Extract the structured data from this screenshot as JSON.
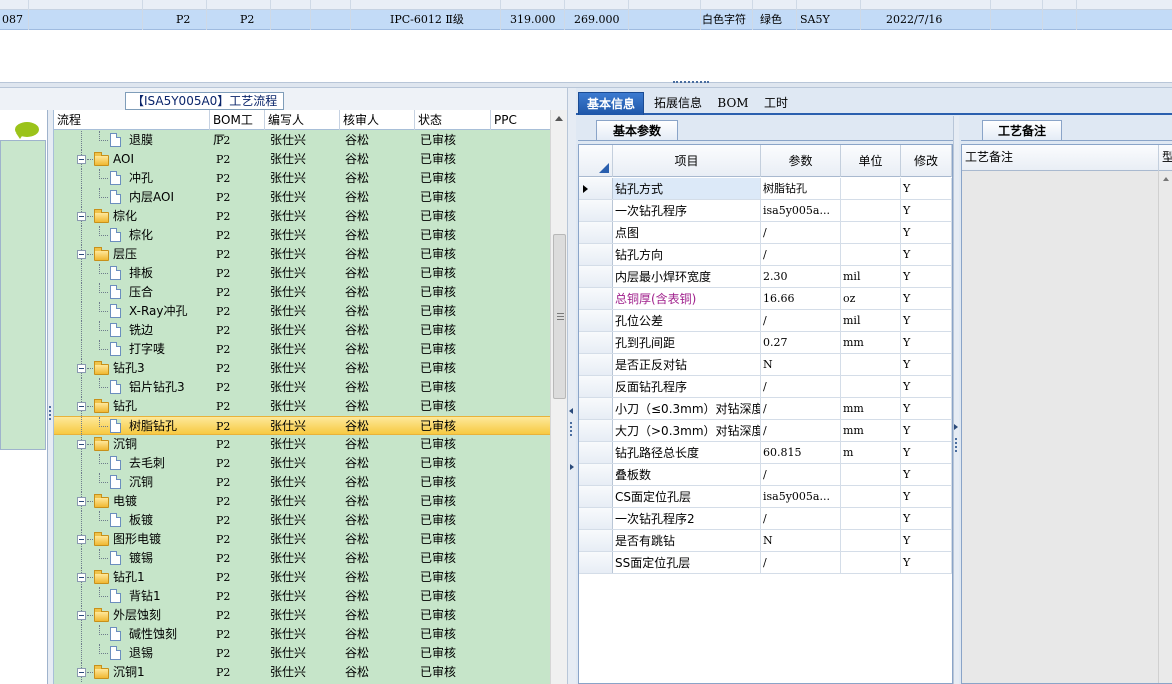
{
  "top_grid": {
    "row": [
      "087",
      "P2",
      "P2",
      "IPC-6012 Ⅱ级",
      "319.000",
      "269.000",
      "白色字符",
      "绿色",
      "SA5Y",
      "2022/7/16"
    ]
  },
  "left_panel": {
    "title": "【ISA5Y005A0】工艺流程",
    "columns": [
      "流程",
      "BOM工厂",
      "编写人",
      "核审人",
      "状态",
      "PPC"
    ],
    "rows": [
      {
        "level": 2,
        "type": "doc",
        "name": "退膜",
        "bom": "P2",
        "writer": "张仕兴",
        "reviewer": "谷松",
        "status": "已审核"
      },
      {
        "level": 1,
        "type": "folder",
        "name": "AOI",
        "bom": "P2",
        "writer": "张仕兴",
        "reviewer": "谷松",
        "status": "已审核"
      },
      {
        "level": 2,
        "type": "doc",
        "name": "冲孔",
        "bom": "P2",
        "writer": "张仕兴",
        "reviewer": "谷松",
        "status": "已审核"
      },
      {
        "level": 2,
        "type": "doc",
        "name": "内层AOI",
        "bom": "P2",
        "writer": "张仕兴",
        "reviewer": "谷松",
        "status": "已审核"
      },
      {
        "level": 1,
        "type": "folder",
        "name": "棕化",
        "bom": "P2",
        "writer": "张仕兴",
        "reviewer": "谷松",
        "status": "已审核"
      },
      {
        "level": 2,
        "type": "doc",
        "name": "棕化",
        "bom": "P2",
        "writer": "张仕兴",
        "reviewer": "谷松",
        "status": "已审核"
      },
      {
        "level": 1,
        "type": "folder",
        "name": "层压",
        "bom": "P2",
        "writer": "张仕兴",
        "reviewer": "谷松",
        "status": "已审核"
      },
      {
        "level": 2,
        "type": "doc",
        "name": "排板",
        "bom": "P2",
        "writer": "张仕兴",
        "reviewer": "谷松",
        "status": "已审核"
      },
      {
        "level": 2,
        "type": "doc",
        "name": "压合",
        "bom": "P2",
        "writer": "张仕兴",
        "reviewer": "谷松",
        "status": "已审核"
      },
      {
        "level": 2,
        "type": "doc",
        "name": "X-Ray冲孔",
        "bom": "P2",
        "writer": "张仕兴",
        "reviewer": "谷松",
        "status": "已审核"
      },
      {
        "level": 2,
        "type": "doc",
        "name": "铣边",
        "bom": "P2",
        "writer": "张仕兴",
        "reviewer": "谷松",
        "status": "已审核"
      },
      {
        "level": 2,
        "type": "doc",
        "name": "打字唛",
        "bom": "P2",
        "writer": "张仕兴",
        "reviewer": "谷松",
        "status": "已审核"
      },
      {
        "level": 1,
        "type": "folder",
        "name": "钻孔3",
        "bom": "P2",
        "writer": "张仕兴",
        "reviewer": "谷松",
        "status": "已审核"
      },
      {
        "level": 2,
        "type": "doc",
        "name": "铝片钻孔3",
        "bom": "P2",
        "writer": "张仕兴",
        "reviewer": "谷松",
        "status": "已审核"
      },
      {
        "level": 1,
        "type": "folder",
        "name": "钻孔",
        "bom": "P2",
        "writer": "张仕兴",
        "reviewer": "谷松",
        "status": "已审核"
      },
      {
        "level": 2,
        "type": "doc",
        "name": "树脂钻孔",
        "bom": "P2",
        "writer": "张仕兴",
        "reviewer": "谷松",
        "status": "已审核",
        "selected": true
      },
      {
        "level": 1,
        "type": "folder",
        "name": "沉铜",
        "bom": "P2",
        "writer": "张仕兴",
        "reviewer": "谷松",
        "status": "已审核"
      },
      {
        "level": 2,
        "type": "doc",
        "name": "去毛刺",
        "bom": "P2",
        "writer": "张仕兴",
        "reviewer": "谷松",
        "status": "已审核"
      },
      {
        "level": 2,
        "type": "doc",
        "name": "沉铜",
        "bom": "P2",
        "writer": "张仕兴",
        "reviewer": "谷松",
        "status": "已审核"
      },
      {
        "level": 1,
        "type": "folder",
        "name": "电镀",
        "bom": "P2",
        "writer": "张仕兴",
        "reviewer": "谷松",
        "status": "已审核"
      },
      {
        "level": 2,
        "type": "doc",
        "name": "板镀",
        "bom": "P2",
        "writer": "张仕兴",
        "reviewer": "谷松",
        "status": "已审核"
      },
      {
        "level": 1,
        "type": "folder",
        "name": "图形电镀",
        "bom": "P2",
        "writer": "张仕兴",
        "reviewer": "谷松",
        "status": "已审核"
      },
      {
        "level": 2,
        "type": "doc",
        "name": "镀锡",
        "bom": "P2",
        "writer": "张仕兴",
        "reviewer": "谷松",
        "status": "已审核"
      },
      {
        "level": 1,
        "type": "folder",
        "name": "钻孔1",
        "bom": "P2",
        "writer": "张仕兴",
        "reviewer": "谷松",
        "status": "已审核"
      },
      {
        "level": 2,
        "type": "doc",
        "name": "背钻1",
        "bom": "P2",
        "writer": "张仕兴",
        "reviewer": "谷松",
        "status": "已审核"
      },
      {
        "level": 1,
        "type": "folder",
        "name": "外层蚀刻",
        "bom": "P2",
        "writer": "张仕兴",
        "reviewer": "谷松",
        "status": "已审核"
      },
      {
        "level": 2,
        "type": "doc",
        "name": "碱性蚀刻",
        "bom": "P2",
        "writer": "张仕兴",
        "reviewer": "谷松",
        "status": "已审核"
      },
      {
        "level": 2,
        "type": "doc",
        "name": "退锡",
        "bom": "P2",
        "writer": "张仕兴",
        "reviewer": "谷松",
        "status": "已审核"
      },
      {
        "level": 1,
        "type": "folder",
        "name": "沉铜1",
        "bom": "P2",
        "writer": "张仕兴",
        "reviewer": "谷松",
        "status": "已审核"
      }
    ]
  },
  "right_panel": {
    "tabs": [
      "基本信息",
      "拓展信息",
      "BOM",
      "工时"
    ],
    "active_tab": 0,
    "subtab": "基本参数",
    "notes_tab": "工艺备注",
    "notes_columns": [
      "工艺备注",
      "型"
    ],
    "params_columns": [
      "项目",
      "参数",
      "单位",
      "修改"
    ],
    "params": [
      {
        "item": "钻孔方式",
        "value": "树脂钻孔",
        "unit": "",
        "mod": "Y",
        "current": true
      },
      {
        "item": "一次钻孔程序",
        "value": "isa5y005a...",
        "unit": "",
        "mod": "Y"
      },
      {
        "item": "点图",
        "value": "/",
        "unit": "",
        "mod": "Y"
      },
      {
        "item": "钻孔方向",
        "value": "/",
        "unit": "",
        "mod": "Y"
      },
      {
        "item": "内层最小焊环宽度",
        "value": "2.30",
        "unit": "mil",
        "mod": "Y"
      },
      {
        "item": "总铜厚(含表铜)",
        "value": "16.66",
        "unit": "oz",
        "mod": "Y",
        "highlight": true
      },
      {
        "item": "孔位公差",
        "value": "/",
        "unit": "mil",
        "mod": "Y"
      },
      {
        "item": "孔到孔间距",
        "value": "0.27",
        "unit": "mm",
        "mod": "Y"
      },
      {
        "item": "是否正反对钻",
        "value": "N",
        "unit": "",
        "mod": "Y"
      },
      {
        "item": "反面钻孔程序",
        "value": "/",
        "unit": "",
        "mod": "Y"
      },
      {
        "item": "小刀（≤0.3mm）对钻深度",
        "value": "/",
        "unit": "mm",
        "mod": "Y"
      },
      {
        "item": "大刀（>0.3mm）对钻深度",
        "value": "/",
        "unit": "mm",
        "mod": "Y"
      },
      {
        "item": "钻孔路径总长度",
        "value": "60.815",
        "unit": "m",
        "mod": "Y"
      },
      {
        "item": "叠板数",
        "value": "/",
        "unit": "",
        "mod": "Y"
      },
      {
        "item": "CS面定位孔层",
        "value": "isa5y005a...",
        "unit": "",
        "mod": "Y"
      },
      {
        "item": "一次钻孔程序2",
        "value": "/",
        "unit": "",
        "mod": "Y"
      },
      {
        "item": "是否有跳钻",
        "value": "N",
        "unit": "",
        "mod": "Y"
      },
      {
        "item": "SS面定位孔层",
        "value": "/",
        "unit": "",
        "mod": "Y"
      }
    ]
  },
  "colors": {
    "tree_bg": "#c6e5c9",
    "selected_row": "#f7c941",
    "tab_active": "#1e56a8",
    "highlight_text": "#a0208c",
    "top_row": "#c3dbf7"
  }
}
